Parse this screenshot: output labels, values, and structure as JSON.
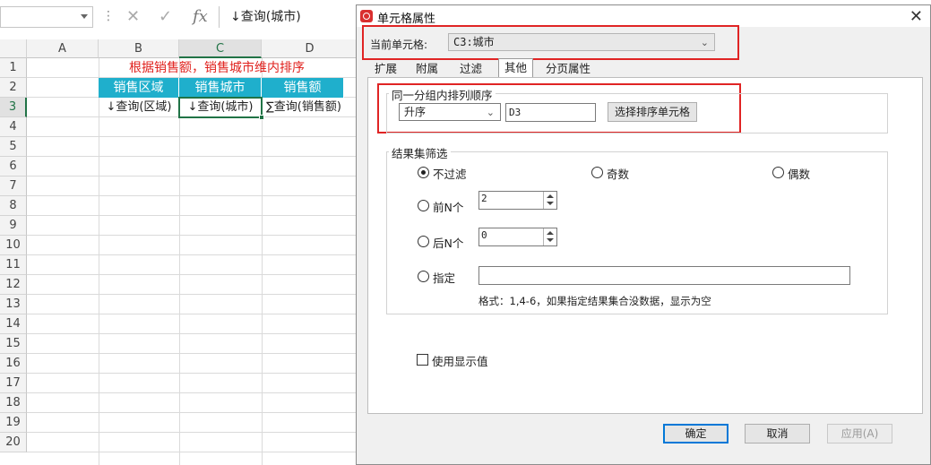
{
  "spreadsheet": {
    "formula_bar": {
      "cell_ref": "",
      "icons": [
        "cancel-icon",
        "check-icon",
        "fx-icon"
      ],
      "fx_label": "fx",
      "content": "↓查询(城市)"
    },
    "columns": [
      "A",
      "B",
      "C",
      "D"
    ],
    "rows": [
      "1",
      "2",
      "3",
      "4",
      "5",
      "6",
      "7",
      "8",
      "9",
      "10",
      "11",
      "12",
      "13",
      "14",
      "15",
      "16",
      "17",
      "18",
      "19",
      "20"
    ],
    "cells": {
      "title": "根据销售额，销售城市维内排序",
      "b2": "销售区域",
      "c2": "销售城市",
      "d2": "销售额",
      "b3": "↓查询(区域)",
      "c3": "↓查询(城市)",
      "d3": "∑查询(销售额)"
    },
    "colors": {
      "header_fill": "#1fafcc",
      "title_text": "#e0211d",
      "selection": "#217346"
    }
  },
  "dialog": {
    "title": "单元格属性",
    "close_label": "✕",
    "current_cell_label": "当前单元格:",
    "current_cell_value": "C3:城市",
    "tabs": [
      "扩展",
      "附属",
      "过滤",
      "其他",
      "分页属性"
    ],
    "active_tab": "其他",
    "sort_group": {
      "title": "同一分组内排列顺序",
      "order_value": "升序",
      "cell_value": "D3",
      "choose_button": "选择排序单元格"
    },
    "filter_group": {
      "title": "结果集筛选",
      "options": {
        "none": "不过滤",
        "odd": "奇数",
        "even": "偶数",
        "top_n": "前N个",
        "bottom_n": "后N个",
        "specify": "指定"
      },
      "selected": "不过滤",
      "top_n_value": "2",
      "bottom_n_value": "0",
      "specify_value": "",
      "hint": "格式：1,4-6，如果指定结果集合没数据，显示为空"
    },
    "use_display_value": {
      "label": "使用显示值",
      "checked": false
    },
    "buttons": {
      "ok": "确定",
      "cancel": "取消",
      "apply": "应用(A)"
    },
    "colors": {
      "highlight_box": "#e02424",
      "primary_border": "#0078d7"
    }
  }
}
